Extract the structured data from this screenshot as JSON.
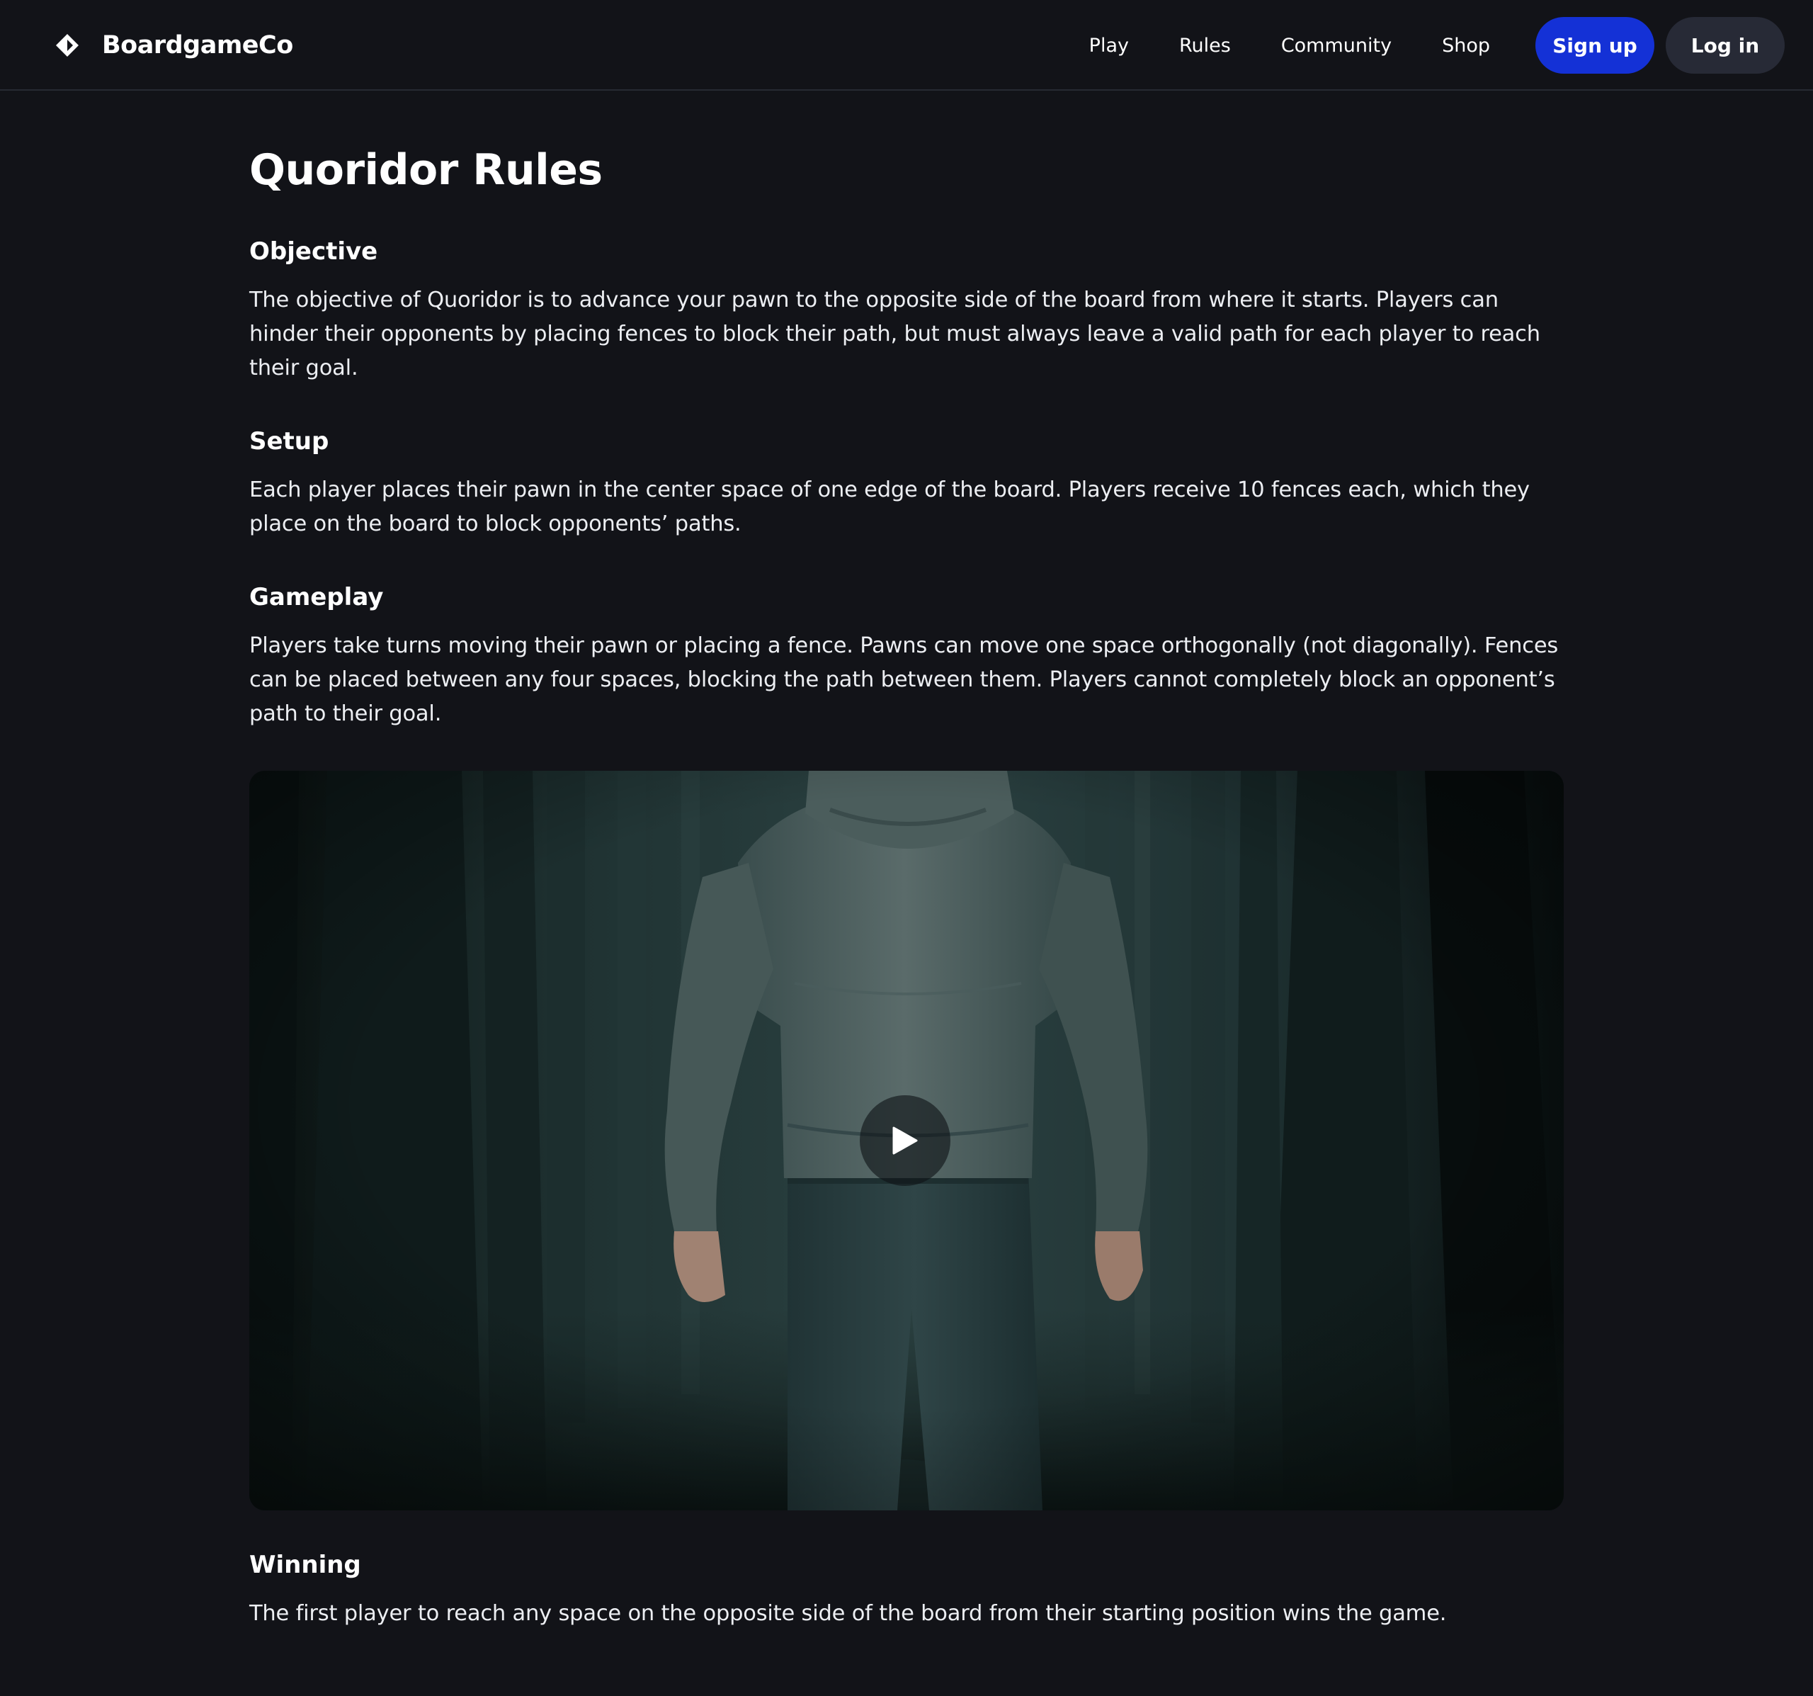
{
  "header": {
    "brand_name": "BoardgameCo",
    "brand_icon": "diamond-logo-icon",
    "nav": [
      {
        "label": "Play"
      },
      {
        "label": "Rules"
      },
      {
        "label": "Community"
      },
      {
        "label": "Shop"
      }
    ],
    "signup_label": "Sign up",
    "login_label": "Log in"
  },
  "page": {
    "title": "Quoridor Rules",
    "sections": [
      {
        "heading": "Objective",
        "body": "The objective of Quoridor is to advance your pawn to the opposite side of the board from where it starts. Players can hinder their opponents by placing fences to block their path, but must always leave a valid path for each player to reach their goal."
      },
      {
        "heading": "Setup",
        "body": "Each player places their pawn in the center space of one edge of the board. Players receive 10 fences each, which they place on the board to block opponents’ paths."
      },
      {
        "heading": "Gameplay",
        "body": "Players take turns moving their pawn or placing a fence. Pawns can move one space orthogonally (not diagonally). Fences can be placed between any four spaces, blocking the path between them. Players cannot completely block an opponent’s path to their goal."
      },
      {
        "heading": "Winning",
        "body": "The first player to reach any space on the opposite side of the board from their starting position wins the game."
      }
    ]
  },
  "video": {
    "play_icon": "play-icon"
  },
  "colors": {
    "background": "#121318",
    "accent": "#1431d6",
    "secondary_button": "#272a36",
    "text": "#ffffff"
  }
}
